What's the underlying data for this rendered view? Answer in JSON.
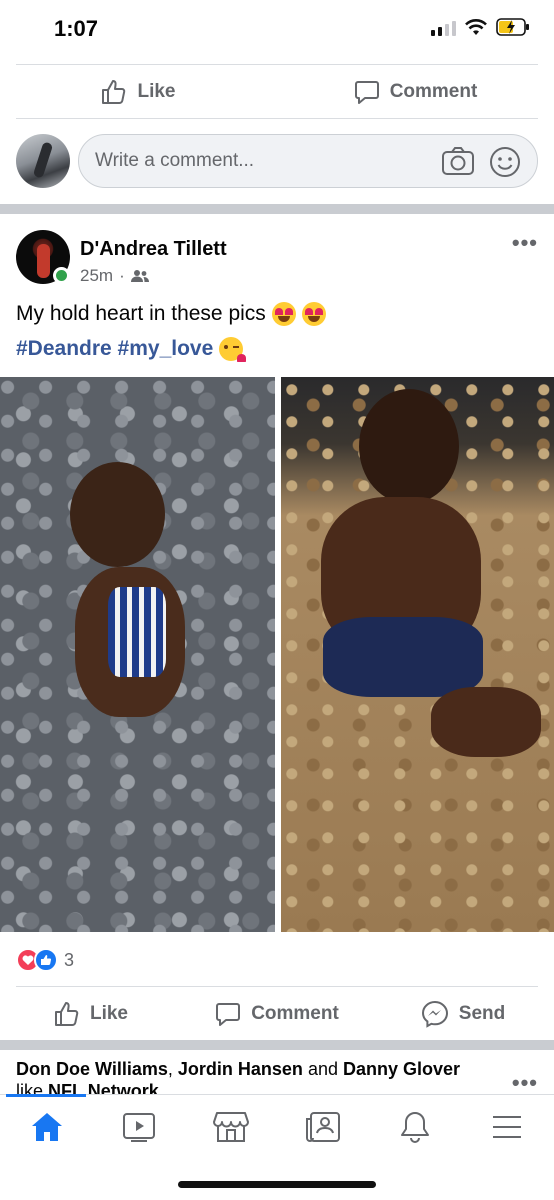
{
  "status_bar": {
    "time": "1:07"
  },
  "top_actions": {
    "like_label": "Like",
    "comment_label": "Comment"
  },
  "comment_box": {
    "placeholder": "Write a comment..."
  },
  "post": {
    "author": "D'Andrea Tillett",
    "time": "25m",
    "privacy_icon": "friends-icon",
    "text": "My hold heart in these pics",
    "hashtags": "#Deandre #my_love",
    "reaction_count": "3",
    "actions": {
      "like_label": "Like",
      "comment_label": "Comment",
      "send_label": "Send"
    }
  },
  "suggestion": {
    "name1": "Don Doe Williams",
    "sep1": ",",
    "name2": "Jordin Hansen",
    "and": "and",
    "name3": "Danny Glover",
    "like": "like",
    "page": "NFL Network"
  },
  "tabbar": {
    "items": [
      "home-icon",
      "video-icon",
      "marketplace-icon",
      "news-icon",
      "notifications-icon",
      "menu-icon"
    ],
    "active": "home-icon",
    "accent": "#1877f2"
  }
}
